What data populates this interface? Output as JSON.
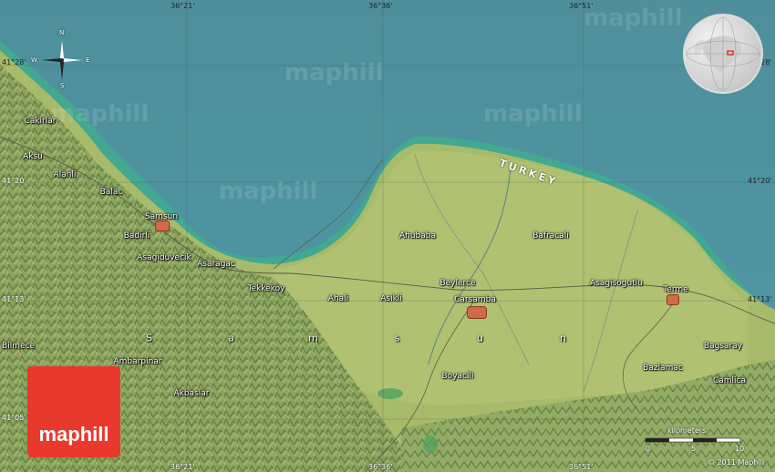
{
  "map": {
    "sea_color": "#4e93a0",
    "land_color": "#a8bb6a",
    "mountain_color": "#7f9a55",
    "coast_color": "#3fae8e",
    "watermark": "maphill",
    "country_label": "TURKEY",
    "region_letters": [
      "S",
      "a",
      "m",
      "s",
      "u",
      "n"
    ],
    "top_coords": [
      "36°21'",
      "36°36'",
      "36°51'"
    ],
    "bottom_coords": [
      "36°21'",
      "36°36'",
      "36°51'"
    ],
    "left_coords": [
      "41°28'",
      "41°20'",
      "41°13'",
      "41°05'"
    ],
    "right_coords": [
      "41°28'",
      "41°20'",
      "41°13'"
    ],
    "places": [
      {
        "id": "cakirlar",
        "name": "Cakirlar"
      },
      {
        "id": "aksu",
        "name": "Aksu"
      },
      {
        "id": "alanli",
        "name": "Alanli"
      },
      {
        "id": "balac",
        "name": "Balac"
      },
      {
        "id": "samsun",
        "name": "Samsun"
      },
      {
        "id": "badirli",
        "name": "Badirli"
      },
      {
        "id": "asagiduvecik",
        "name": "Asagiduvecik"
      },
      {
        "id": "asaragac",
        "name": "Asaragac"
      },
      {
        "id": "tekkekoy",
        "name": "Tekkekoy"
      },
      {
        "id": "ahali",
        "name": "Ahali"
      },
      {
        "id": "asikli",
        "name": "Asikli"
      },
      {
        "id": "ahubaba",
        "name": "Ahubaba"
      },
      {
        "id": "bafracali",
        "name": "Bafracali"
      },
      {
        "id": "beylerce",
        "name": "Beylerce"
      },
      {
        "id": "carsamba",
        "name": "Carsamba"
      },
      {
        "id": "asagisogutlu",
        "name": "Asagisogutlu"
      },
      {
        "id": "terme",
        "name": "Terme"
      },
      {
        "id": "bagsaray",
        "name": "Bagsaray"
      },
      {
        "id": "bazlamac",
        "name": "Bazlamac"
      },
      {
        "id": "camlica",
        "name": "Camlica"
      },
      {
        "id": "boyacili",
        "name": "Boyacili"
      },
      {
        "id": "bilmece",
        "name": "Bilmece"
      },
      {
        "id": "ambarpinar",
        "name": "Ambarpinar"
      },
      {
        "id": "akbaslar",
        "name": "Akbaslar"
      }
    ],
    "compass": {
      "n": "N",
      "s": "S",
      "e": "E",
      "w": "W"
    },
    "scale": {
      "unit": "kilometers",
      "ticks": [
        "0",
        "5",
        "10"
      ]
    },
    "logo_text": "maphill",
    "copyright": "© 2011 Maphill"
  }
}
